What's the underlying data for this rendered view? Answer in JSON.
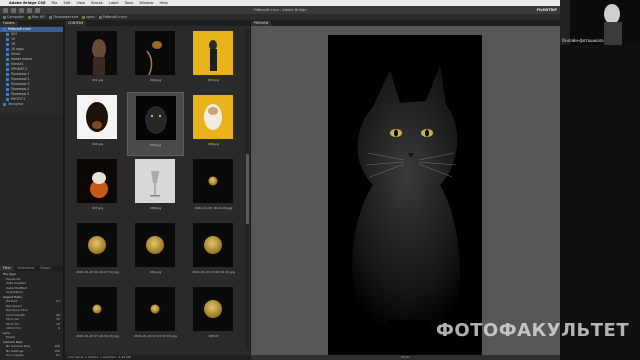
{
  "menubar": {
    "app_name": "Adobe Bridge CS6",
    "items": [
      "File",
      "Edit",
      "View",
      "Stacks",
      "Label",
      "Tools",
      "Window",
      "Help"
    ]
  },
  "window": {
    "title": "Рабочий стол - Adobe Bridge",
    "workspace": "FILMSTRIP"
  },
  "path": [
    "Computer",
    "Mac HD",
    "Пользователи",
    "sport",
    "Рабочий стол"
  ],
  "panels": {
    "left_tab_active": "Folders",
    "content_tab": "CONTENT",
    "preview_tab": "PREVIEW",
    "filter_tabs": [
      "Filter",
      "Collections",
      "Export"
    ]
  },
  "folders": [
    {
      "label": "Рабочий стол",
      "level": 0,
      "selected": true
    },
    {
      "label": "003",
      "level": 1
    },
    {
      "label": "10",
      "level": 1
    },
    {
      "label": "18",
      "level": 1
    },
    {
      "label": "18 apps",
      "level": 1
    },
    {
      "label": "Shoot",
      "level": 1
    },
    {
      "label": "Новая папка",
      "level": 1
    },
    {
      "label": "Папка1",
      "level": 1
    },
    {
      "label": "ПРИМЕР 2",
      "level": 1
    },
    {
      "label": "Примеры 1",
      "level": 1
    },
    {
      "label": "Примеры 2",
      "level": 1
    },
    {
      "label": "Примеры 3",
      "level": 1
    },
    {
      "label": "Примеры 4",
      "level": 1
    },
    {
      "label": "Примеры 5",
      "level": 1
    },
    {
      "label": "PHOTO 5",
      "level": 1
    },
    {
      "label": "Загрузки",
      "level": 0
    }
  ],
  "filters": [
    {
      "label": "File Type",
      "count": "",
      "head": true
    },
    {
      "label": "Keywords",
      "count": ""
    },
    {
      "label": "Date Created",
      "count": ""
    },
    {
      "label": "Date Modified",
      "count": ""
    },
    {
      "label": "Orientation",
      "count": ""
    },
    {
      "label": "Aspect Ratio",
      "count": "",
      "head": true
    },
    {
      "label": "Portrait",
      "count": "61"
    },
    {
      "label": "ISO Speed",
      "count": ""
    },
    {
      "label": "Exposure Time",
      "count": ""
    },
    {
      "label": "Focal Length",
      "count": "46"
    },
    {
      "label": "50.0 mm",
      "count": "12"
    },
    {
      "label": "60.0 mm",
      "count": "10"
    },
    {
      "label": "100.0 mm",
      "count": "9"
    },
    {
      "label": "Lens",
      "count": "",
      "head": true
    },
    {
      "label": "Model",
      "count": ""
    },
    {
      "label": "Camera Raw",
      "count": "",
      "head": true
    },
    {
      "label": "No Camera Raw",
      "count": "140"
    },
    {
      "label": "No Settings",
      "count": "100"
    },
    {
      "label": "Un-cropped",
      "count": "81"
    }
  ],
  "thumbnails": [
    {
      "label": "001.jpg",
      "kind": "dark-woman"
    },
    {
      "label": "002.jpg",
      "kind": "dark-figure"
    },
    {
      "label": "003.jpg",
      "kind": "yellow-figure"
    },
    {
      "label": "004.jpg",
      "kind": "dog"
    },
    {
      "label": "005.jpg",
      "kind": "black-cat",
      "selected": true
    },
    {
      "label": "006.jpg",
      "kind": "yellow-dog"
    },
    {
      "label": "007.jpg",
      "kind": "mouse"
    },
    {
      "label": "008.jpg",
      "kind": "glass"
    },
    {
      "label": "2021-01-20 16-19-06.jpg",
      "kind": "coin-small"
    },
    {
      "label": "2021-01-20 16-14-07 (1).jpg",
      "kind": "coin-big"
    },
    {
      "label": "001.jpg",
      "kind": "coin-big"
    },
    {
      "label": "2021-01-20 17-00-56 (2).jpg",
      "kind": "coin-big"
    },
    {
      "label": "2021-01-20 17-10-50 (2).jpg",
      "kind": "coin-small"
    },
    {
      "label": "2021-01-20 17-07-50 (2).jpg",
      "kind": "coin-small"
    },
    {
      "label": "005.tif",
      "kind": "coin-big"
    }
  ],
  "content_status": "241 items, 2 hidden, 1 selected - 4.49 MB",
  "preview_status": "Photo",
  "webcam": {
    "caption": "Онлайн-фотошкола"
  },
  "watermark": "ФОТОФАКУЛЬТЕТ",
  "colors": {
    "selection": "#3a5f94",
    "folder": "#3c7fcf",
    "preview_bg": "#575757",
    "panel_bg": "#2a2a2a"
  }
}
